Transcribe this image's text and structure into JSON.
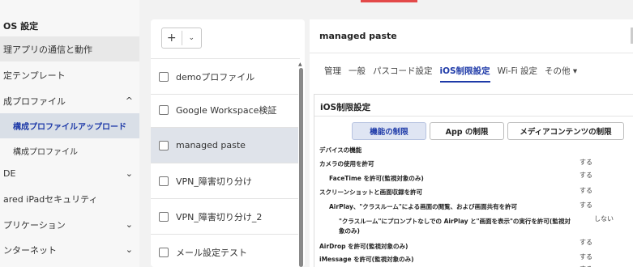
{
  "sidebar": {
    "title": "OS 設定",
    "items": [
      {
        "label": "理アプリの通信と動作"
      },
      {
        "label": "定テンプレート"
      },
      {
        "label": "成プロファイル",
        "chevron": "^"
      },
      {
        "label": "構成プロファイルアップロード"
      },
      {
        "label": "構成プロファイル"
      },
      {
        "label": "DE",
        "chevron": "⌄"
      },
      {
        "label": "ared iPadセキュリティ"
      },
      {
        "label": "プリケーション",
        "chevron": "⌄"
      },
      {
        "label": "ンターネット",
        "chevron": "⌄"
      }
    ]
  },
  "toolbar": {
    "add_label": "+",
    "caret_label": "⌄"
  },
  "profiles": [
    {
      "name": "demoプロファイル"
    },
    {
      "name": "Google Workspace検証"
    },
    {
      "name": "managed paste"
    },
    {
      "name": "VPN_障害切り分け"
    },
    {
      "name": "VPN_障害切り分け_2"
    },
    {
      "name": "メール設定テスト"
    }
  ],
  "detail": {
    "title": "managed paste",
    "tabs": [
      {
        "label": "管理"
      },
      {
        "label": "一般"
      },
      {
        "label": "パスコード設定"
      },
      {
        "label": "iOS制限設定"
      },
      {
        "label": "Wi-Fi 設定"
      },
      {
        "label": "その他 ▾"
      }
    ],
    "section_title": "iOS制限設定",
    "segments": [
      {
        "label": "機能の制限"
      },
      {
        "label": "App の制限"
      },
      {
        "label": "メディアコンテンツの制限"
      }
    ],
    "rows": [
      {
        "label": "デバイスの機能",
        "value": ""
      },
      {
        "label": "カメラの使用を許可",
        "value": "する"
      },
      {
        "label": "FaceTime を許可(監視対象のみ)",
        "value": "する"
      },
      {
        "label": "スクリーンショットと画面収録を許可",
        "value": "する"
      },
      {
        "label": "AirPlay、\"クラスルーム\"による画面の閲覧、および画面共有を許可",
        "value": "する"
      },
      {
        "label": "\"クラスルーム\"にプロンプトなしでの AirPlay と\"画面を表示\"の実行を許可(監視対",
        "value": "しない"
      },
      {
        "label": "象のみ)",
        "value": ""
      },
      {
        "label": "AirDrop を許可(監視対象のみ)",
        "value": "する"
      },
      {
        "label": "iMessage を許可(監視対象のみ)",
        "value": "する"
      },
      {
        "label": "",
        "value": "する"
      }
    ]
  }
}
